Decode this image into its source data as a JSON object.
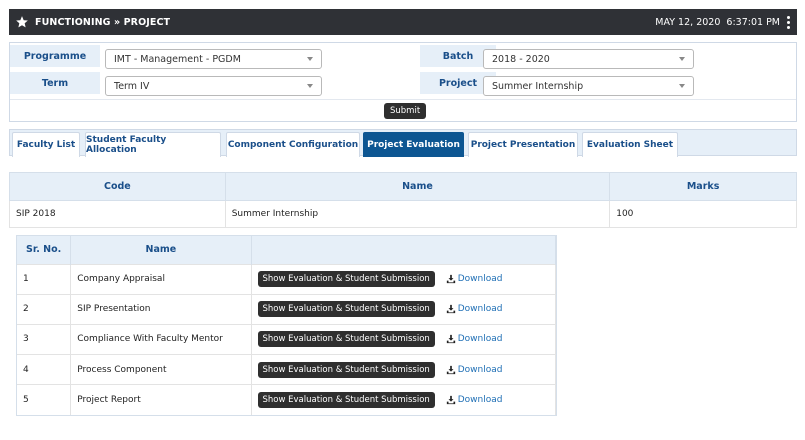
{
  "header": {
    "title": "FUNCTIONING » PROJECT",
    "date": "MAY 12, 2020",
    "time": "6:37:01 PM"
  },
  "filters": {
    "programme_label": "Programme",
    "programme_value": "IMT - Management - PGDM",
    "batch_label": "Batch",
    "batch_value": "2018 - 2020",
    "term_label": "Term",
    "term_value": "Term IV",
    "project_label": "Project",
    "project_value": "Summer Internship",
    "submit_label": "Submit"
  },
  "tabs": [
    {
      "label": "Faculty List"
    },
    {
      "label": "Student Faculty Allocation"
    },
    {
      "label": "Component Configuration"
    },
    {
      "label": "Project Evaluation"
    },
    {
      "label": "Project Presentation"
    },
    {
      "label": "Evaluation Sheet"
    }
  ],
  "active_tab": "Project Evaluation",
  "project_table": {
    "headers": [
      "Code",
      "Name",
      "Marks"
    ],
    "row": {
      "code": "SIP 2018",
      "name": "Summer Internship",
      "marks": "100"
    }
  },
  "components_table": {
    "headers": [
      "Sr. No.",
      "Name",
      ""
    ],
    "action_label": "Show Evaluation & Student Submission",
    "download_label": "Download",
    "rows": [
      {
        "sr": "1",
        "name": "Company Appraisal"
      },
      {
        "sr": "2",
        "name": "SIP Presentation"
      },
      {
        "sr": "3",
        "name": "Compliance With Faculty Mentor"
      },
      {
        "sr": "4",
        "name": "Process Component"
      },
      {
        "sr": "5",
        "name": "Project Report"
      }
    ]
  },
  "colors": {
    "header_bg": "#2f3136",
    "accent": "#0d5692",
    "label_bg": "#e6eff8",
    "link": "#1f6fb5"
  }
}
